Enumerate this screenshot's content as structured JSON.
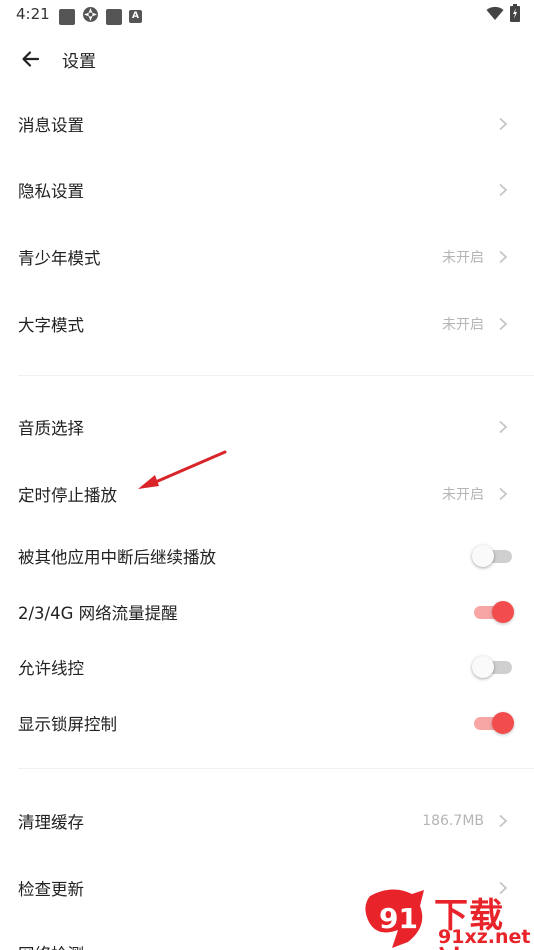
{
  "status_bar": {
    "time": "4:21",
    "left_icons": [
      "square-icon",
      "aperture-icon",
      "square-icon",
      "a-badge-icon"
    ],
    "a_badge": "A",
    "right_icons": [
      "wifi-icon",
      "battery-icon"
    ]
  },
  "header": {
    "title": "设置"
  },
  "settings": {
    "message": {
      "label": "消息设置"
    },
    "privacy": {
      "label": "隐私设置"
    },
    "youth_mode": {
      "label": "青少年模式",
      "value": "未开启"
    },
    "large_text": {
      "label": "大字模式",
      "value": "未开启"
    },
    "audio_quality": {
      "label": "音质选择"
    },
    "sleep_timer": {
      "label": "定时停止播放",
      "value": "未开启"
    },
    "resume_after_interrupt": {
      "label": "被其他应用中断后继续播放",
      "enabled": false
    },
    "network_reminder": {
      "label": "2/3/4G 网络流量提醒",
      "enabled": true
    },
    "wire_control": {
      "label": "允许线控",
      "enabled": false
    },
    "lockscreen_control": {
      "label": "显示锁屏控制",
      "enabled": true
    },
    "clear_cache": {
      "label": "清理缓存",
      "value": "186.7MB"
    },
    "check_update": {
      "label": "检查更新"
    },
    "network_check": {
      "label": "网络检测"
    }
  },
  "watermark": {
    "top": "下载站",
    "bottom": "91xz.net",
    "logo_text": "91"
  },
  "colors": {
    "accent": "#f24c4c",
    "accent_track": "#f7a5a5",
    "value_text": "#b5b5b5",
    "annotation_arrow": "#d9242a"
  }
}
